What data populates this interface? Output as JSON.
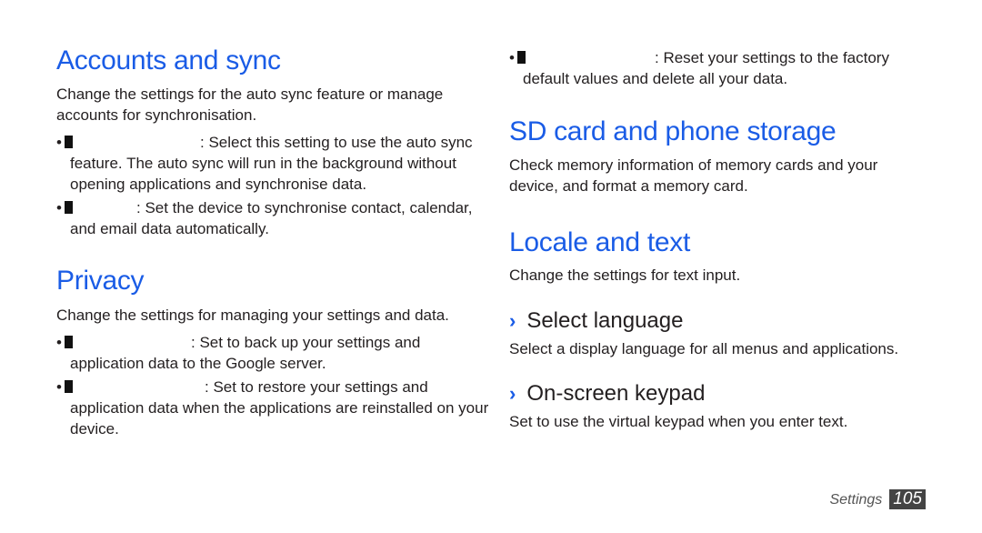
{
  "left": {
    "accounts": {
      "title": "Accounts and sync",
      "intro": "Change the settings for the auto sync feature or manage accounts for synchronisation.",
      "items": [
        {
          "text": ": Select this setting to use the auto sync feature. The auto sync will run in the background without opening applications and synchronise data."
        },
        {
          "text": ": Set the device to synchronise contact, calendar, and email data automatically."
        }
      ]
    },
    "privacy": {
      "title": "Privacy",
      "intro": "Change the settings for managing your settings and data.",
      "items": [
        {
          "text": ": Set to back up your settings and application data to the Google server."
        },
        {
          "text": ": Set to restore your settings and application data when the applications are reinstalled on your device."
        }
      ]
    }
  },
  "right": {
    "factory": {
      "text": ": Reset your settings to the factory default values and delete all your data."
    },
    "sd": {
      "title": "SD card and phone storage",
      "intro": "Check memory information of memory cards and your device, and format a memory card."
    },
    "locale": {
      "title": "Locale and text",
      "intro": "Change the settings for text input.",
      "subs": [
        {
          "chevron": "›",
          "title": "Select language",
          "desc": "Select a display language for all menus and applications."
        },
        {
          "chevron": "›",
          "title": "On-screen keypad",
          "desc": "Set to use the virtual keypad when you enter text."
        }
      ]
    }
  },
  "footer": {
    "section": "Settings",
    "page": "105"
  },
  "bullet_char": "•"
}
